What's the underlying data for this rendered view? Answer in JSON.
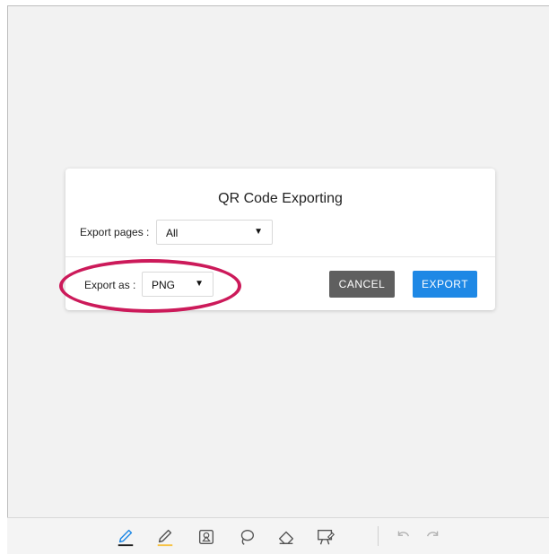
{
  "dialog": {
    "title": "QR Code Exporting",
    "export_pages_label": "Export pages :",
    "export_pages_value": "All",
    "export_as_label": "Export as :",
    "export_as_value": "PNG",
    "dropdown_arrow": "▼",
    "cancel_label": "CANCEL",
    "export_label": "EXPORT"
  },
  "colors": {
    "highlight": "#cc1a5a",
    "export_button": "#1e88e5",
    "cancel_button": "#5f5f5f",
    "pen_underline": "#1e1e1e",
    "highlighter_underline": "#f6c244"
  },
  "toolbar": {
    "tools": [
      "pen-icon",
      "highlighter-icon",
      "shapes-icon",
      "lasso-icon",
      "eraser-icon",
      "present-icon",
      "undo-icon",
      "redo-icon"
    ]
  }
}
